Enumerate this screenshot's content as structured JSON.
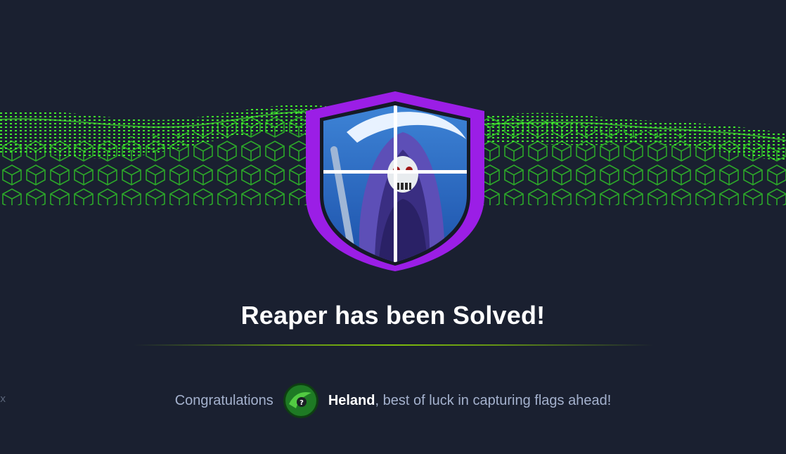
{
  "modal": {
    "machine_name": "Reaper",
    "title": "Reaper has been Solved!",
    "congrats_prefix": "Congratulations",
    "username": "Heland",
    "congrats_suffix": ", best of luck in capturing flags ahead!"
  },
  "icons": {
    "badge": "grim-reaper-shield-badge-icon",
    "avatar": "user-avatar-icon"
  },
  "colors": {
    "background": "#1a2030",
    "badge_border": "#9b1ee6",
    "accent_green": "#9fef00",
    "wave_green": "#3be82a",
    "text_muted": "#a4b1cd",
    "text_primary": "#ffffff"
  }
}
